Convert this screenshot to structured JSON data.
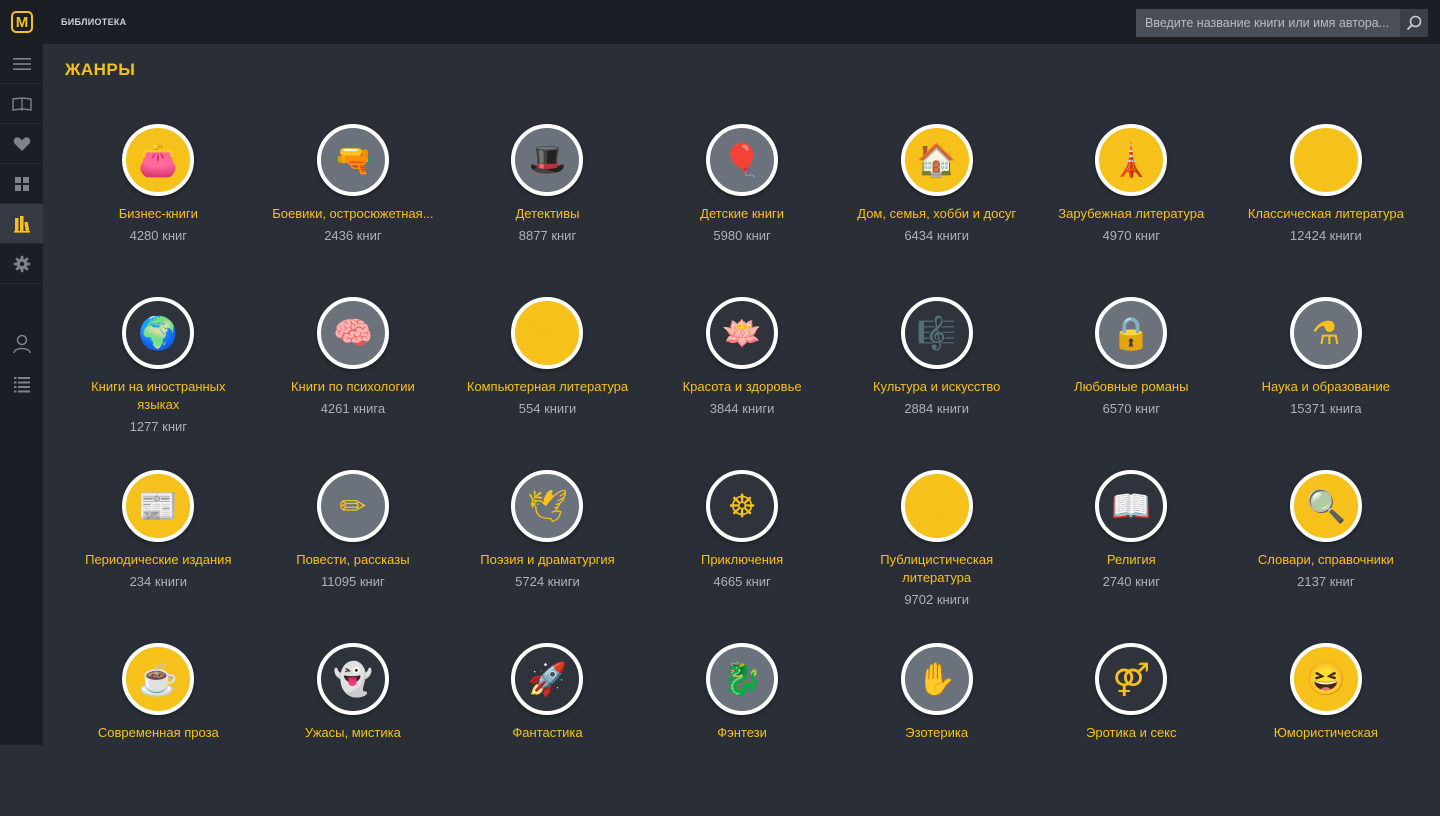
{
  "app": {
    "logo": "M",
    "title": "БИБЛИОТЕКА",
    "search_placeholder": "Введите название книги или имя автора..."
  },
  "page": {
    "title": "ЖАНРЫ"
  },
  "sidebar": {
    "items": [
      {
        "icon": "menu-icon"
      },
      {
        "icon": "book-icon"
      },
      {
        "icon": "heart-icon"
      },
      {
        "icon": "grid-icon"
      },
      {
        "icon": "genres-icon",
        "active": true
      },
      {
        "icon": "settings-icon"
      },
      {
        "icon": "user-icon"
      },
      {
        "icon": "list-icon"
      }
    ]
  },
  "colors": {
    "accent": "#f5c11a",
    "background": "#2a2e37",
    "bar": "#1b1e24",
    "count": "#aab0b8"
  },
  "genres": [
    {
      "name": "Бизнес-книги",
      "count": "4280 книг",
      "icon": "wallet-icon",
      "glyph": "👛",
      "bg": "y"
    },
    {
      "name": "Боевики, остросюжетная...",
      "count": "2436 книг",
      "icon": "gun-icon",
      "glyph": "🔫",
      "bg": "g"
    },
    {
      "name": "Детективы",
      "count": "8877 книг",
      "icon": "detective-hat-icon",
      "glyph": "🎩",
      "bg": "g"
    },
    {
      "name": "Детские книги",
      "count": "5980 книг",
      "icon": "balloons-icon",
      "glyph": "🎈",
      "bg": "g"
    },
    {
      "name": "Дом, семья, хобби и досуг",
      "count": "6434 книги",
      "icon": "house-icon",
      "glyph": "🏠",
      "bg": "y"
    },
    {
      "name": "Зарубежная литература",
      "count": "4970 книг",
      "icon": "landmarks-icon",
      "glyph": "🗼",
      "bg": "y"
    },
    {
      "name": "Классическая литература",
      "count": "12424 книги",
      "icon": "inkwell-icon",
      "glyph": "✒",
      "bg": "y"
    },
    {
      "name": "Книги на иностранных языках",
      "count": "1277 книг",
      "icon": "globe-icon",
      "glyph": "🌍",
      "bg": "d"
    },
    {
      "name": "Книги по психологии",
      "count": "4261 книга",
      "icon": "brain-icon",
      "glyph": "🧠",
      "bg": "g"
    },
    {
      "name": "Компьютерная литература",
      "count": "554 книги",
      "icon": "monitor-icon",
      "glyph": "🖥",
      "bg": "y"
    },
    {
      "name": "Красота и здоровье",
      "count": "3844 книги",
      "icon": "lotus-icon",
      "glyph": "🪷",
      "bg": "d"
    },
    {
      "name": "Культура и искусство",
      "count": "2884 книги",
      "icon": "lyre-icon",
      "glyph": "🎼",
      "bg": "d"
    },
    {
      "name": "Любовные романы",
      "count": "6570 книг",
      "icon": "heart-lock-icon",
      "glyph": "🔒",
      "bg": "g"
    },
    {
      "name": "Наука и образование",
      "count": "15371 книга",
      "icon": "flask-icon",
      "glyph": "⚗",
      "bg": "g"
    },
    {
      "name": "Периодические издания",
      "count": "234 книги",
      "icon": "newspaper-icon",
      "glyph": "📰",
      "bg": "y"
    },
    {
      "name": "Повести, рассказы",
      "count": "11095 книг",
      "icon": "pencil-icon",
      "glyph": "✏",
      "bg": "g"
    },
    {
      "name": "Поэзия и драматургия",
      "count": "5724 книги",
      "icon": "dove-icon",
      "glyph": "🕊",
      "bg": "g"
    },
    {
      "name": "Приключения",
      "count": "4665 книг",
      "icon": "ship-wheel-icon",
      "glyph": "☸",
      "bg": "d"
    },
    {
      "name": "Публицистическая литература",
      "count": "9702 книги",
      "icon": "typewriter-icon",
      "glyph": "⌨",
      "bg": "y"
    },
    {
      "name": "Религия",
      "count": "2740 книг",
      "icon": "open-book-rays-icon",
      "glyph": "📖",
      "bg": "d"
    },
    {
      "name": "Словари, справочники",
      "count": "2137 книг",
      "icon": "magnifier-icon",
      "glyph": "🔍",
      "bg": "y"
    },
    {
      "name": "Современная проза",
      "count": "",
      "icon": "coffee-cup-icon",
      "glyph": "☕",
      "bg": "y"
    },
    {
      "name": "Ужасы, мистика",
      "count": "",
      "icon": "scream-mask-icon",
      "glyph": "👻",
      "bg": "d"
    },
    {
      "name": "Фантастика",
      "count": "",
      "icon": "rocket-icon",
      "glyph": "🚀",
      "bg": "d"
    },
    {
      "name": "Фэнтези",
      "count": "",
      "icon": "dragon-icon",
      "glyph": "🐉",
      "bg": "g"
    },
    {
      "name": "Эзотерика",
      "count": "",
      "icon": "hamsa-icon",
      "glyph": "✋",
      "bg": "g"
    },
    {
      "name": "Эротика и секс",
      "count": "",
      "icon": "gender-icon",
      "glyph": "⚤",
      "bg": "d"
    },
    {
      "name": "Юмористическая",
      "count": "",
      "icon": "laughing-face-icon",
      "glyph": "😆",
      "bg": "y"
    }
  ]
}
